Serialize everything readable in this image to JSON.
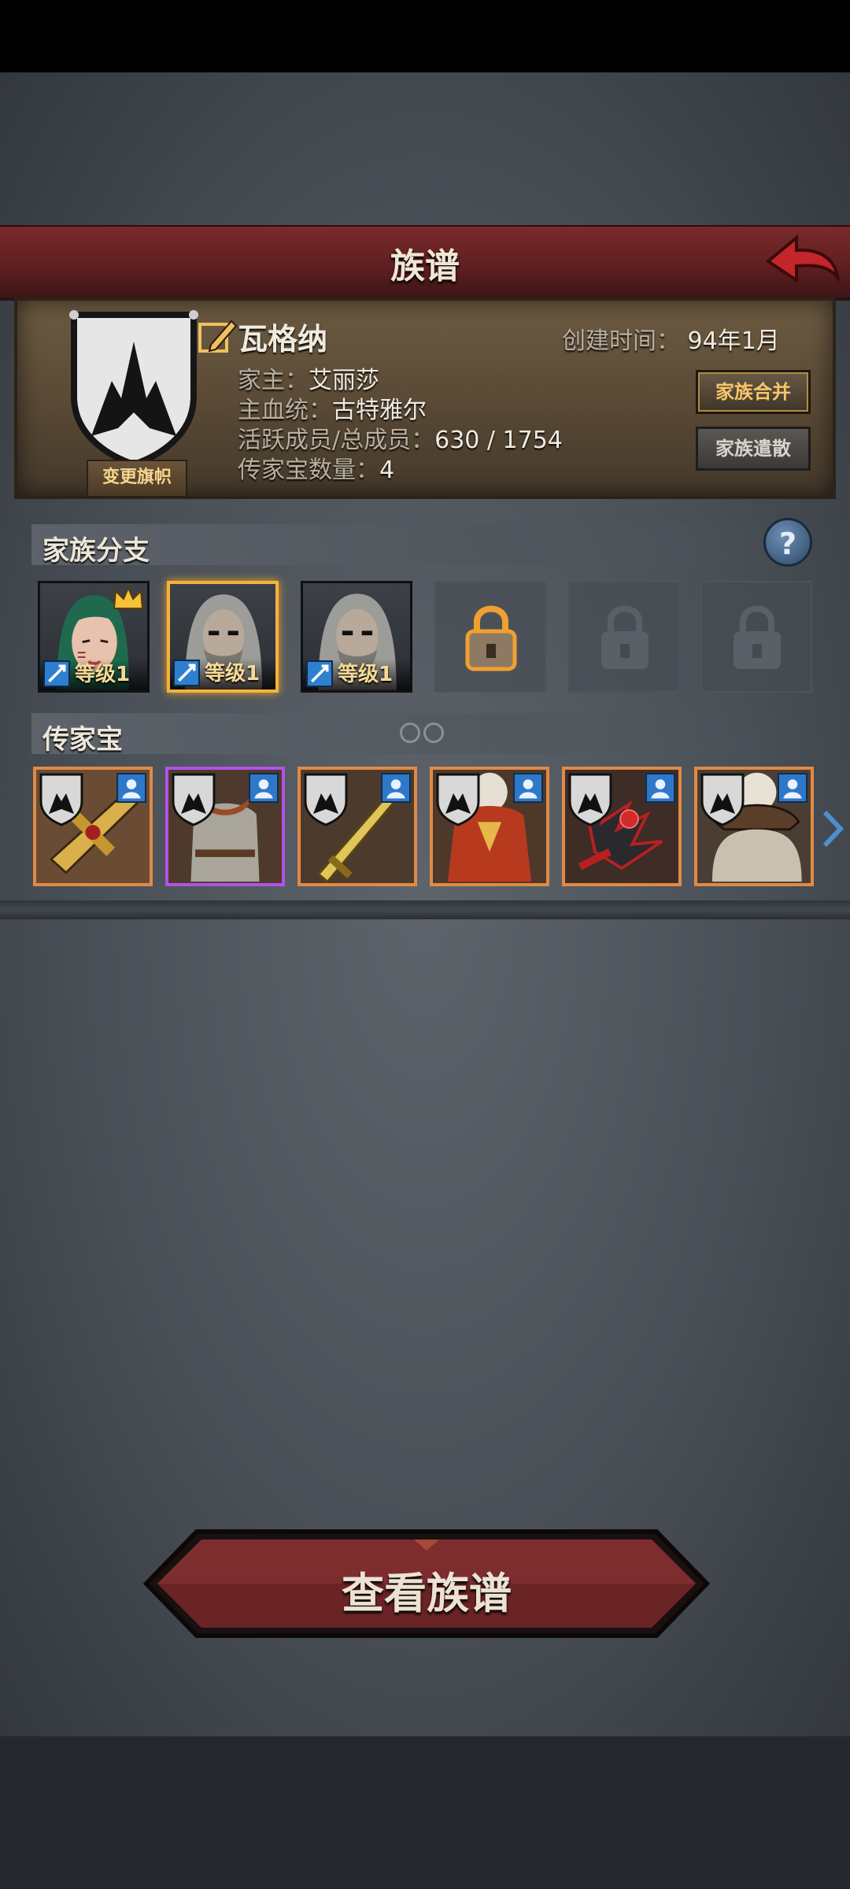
{
  "header": {
    "title": "族谱"
  },
  "info": {
    "change_flag_label": "变更旗帜",
    "family_name": "瓦格纳",
    "created_label": "创建时间：",
    "created_value": "94年1月",
    "head_label": "家主：",
    "head_value": "艾丽莎",
    "bloodline_label": "主血统：",
    "bloodline_value": "古特雅尔",
    "members_label": "活跃成员/总成员：",
    "members_value": "630 / 1754",
    "heirloom_count_label": "传家宝数量：",
    "heirloom_count_value": "4",
    "merge_label": "家族合并",
    "disband_label": "家族遣散"
  },
  "branches": {
    "title": "家族分支",
    "help_label": "?",
    "slots": [
      {
        "level": "等级1",
        "state": "member",
        "leader": true
      },
      {
        "level": "等级1",
        "state": "member",
        "selected": true
      },
      {
        "level": "等级1",
        "state": "member"
      },
      {
        "state": "unlockable"
      },
      {
        "state": "locked"
      },
      {
        "state": "locked"
      }
    ]
  },
  "heirlooms": {
    "title": "传家宝",
    "items": [
      {
        "name": "golden-crossbow",
        "rarity": "orange"
      },
      {
        "name": "chainmail-armor",
        "rarity": "purple"
      },
      {
        "name": "golden-sword",
        "rarity": "orange"
      },
      {
        "name": "red-ornate-armor",
        "rarity": "orange"
      },
      {
        "name": "spiked-mace",
        "rarity": "orange"
      },
      {
        "name": "fur-hat",
        "rarity": "orange"
      }
    ],
    "pages": 2
  },
  "footer": {
    "view_button_label": "查看族谱"
  },
  "colors": {
    "accent": "#f3b43b",
    "header": "#6a2224",
    "orange_frame": "#e08a45",
    "purple_frame": "#b351e6"
  }
}
